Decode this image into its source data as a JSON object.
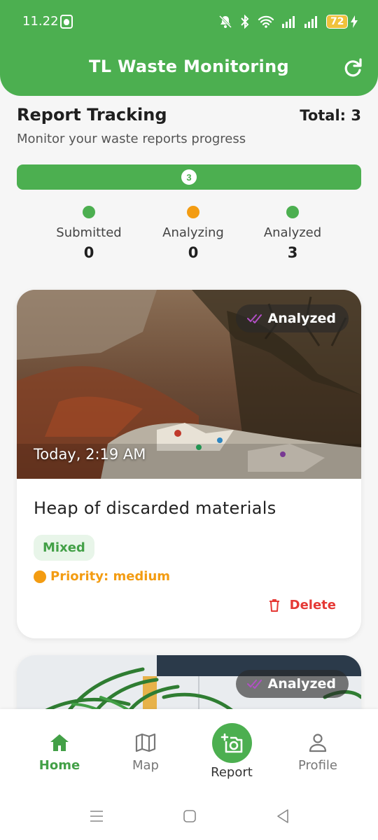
{
  "status_bar": {
    "time": "11.22",
    "battery": "72"
  },
  "header": {
    "title": "TL Waste Monitoring",
    "refresh_icon": "refresh-icon"
  },
  "tracking": {
    "title": "Report Tracking",
    "total_label": "Total: 3",
    "subtitle": "Monitor your waste reports progress",
    "progress_count": "3",
    "progress_fraction": 1.0,
    "stats": [
      {
        "label": "Submitted",
        "value": "0",
        "color": "#4caf50"
      },
      {
        "label": "Analyzing",
        "value": "0",
        "color": "#f39c12"
      },
      {
        "label": "Analyzed",
        "value": "3",
        "color": "#4caf50"
      }
    ]
  },
  "reports": [
    {
      "status": "Analyzed",
      "time": "Today, 2:19 AM",
      "title": "Heap of discarded materials",
      "type": "Mixed",
      "priority": "Priority: medium",
      "delete_label": "Delete"
    },
    {
      "status": "Analyzed"
    }
  ],
  "nav": {
    "home": "Home",
    "map": "Map",
    "report": "Report",
    "profile": "Profile"
  },
  "colors": {
    "primary": "#4caf50",
    "warning": "#f39c12",
    "danger": "#e53935"
  }
}
